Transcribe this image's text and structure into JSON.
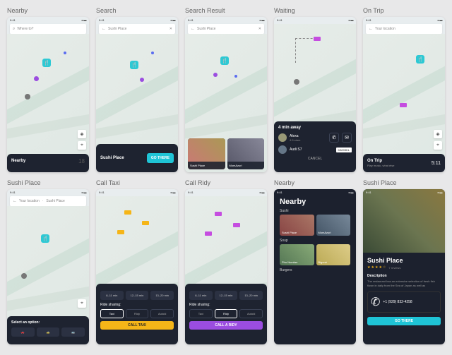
{
  "status": {
    "time": "9:41",
    "icons": "••• ▬"
  },
  "screens": {
    "nearby": {
      "label": "Nearby",
      "search": "Where to?",
      "sheet_title": "Nearby",
      "sheet_num": "18"
    },
    "search": {
      "label": "Search",
      "input": "Sushi Place",
      "card_title": "Sushi Place",
      "card_sub": "",
      "btn": "GO THERE"
    },
    "search_result": {
      "label": "Search Result",
      "input": "Sushi Place",
      "card1": "Sushi Place",
      "card1_sub": "",
      "card2": "MomAzuri",
      "card2_sub": ""
    },
    "waiting": {
      "label": "Waiting",
      "title": "4 min away",
      "driver": "Alexa",
      "rating": "4.5 stars",
      "car": "Audi S7",
      "plate": "K8203KL",
      "cancel": "CANCEL"
    },
    "on_trip": {
      "label": "On Trip",
      "search": "Your location",
      "title": "On Trip",
      "sub": "Play music, what else",
      "time": "5:11"
    },
    "sushi_place": {
      "label": "Sushi Place",
      "crumb1": "Your location",
      "crumb2": "Sushi Place",
      "title": "Select an option:"
    },
    "call_taxi": {
      "label": "Call Taxi",
      "chip1": "8–11 min",
      "chip2": "12–15 min",
      "chip3": "13–20 min",
      "share": "Ride sharing:",
      "p1": "Taxi",
      "p2": "Ridy",
      "p3": "Autoid",
      "btn": "CALL TAXI"
    },
    "call_ridy": {
      "label": "Call Ridy",
      "chip1": "8–11 min",
      "chip2": "12–15 min",
      "chip3": "13–20 min",
      "share": "Ride sharing:",
      "p1": "Taxi",
      "p2": "Ridy",
      "p3": "Autoid",
      "btn": "CALL A RIDY"
    },
    "nearby2": {
      "label": "Nearby",
      "title": "Nearby",
      "cat1": "Sushi",
      "c1a": "Sushi Place",
      "c1b": "MomAzuri",
      "cat2": "Soup",
      "c2a": "Pho Number",
      "c2b": "Bigoné",
      "cat3": "Burgers"
    },
    "detail": {
      "label": "Sushi Place",
      "name": "Sushi Place",
      "reviews": "7 reviews",
      "desc_h": "Description",
      "desc": "The restaurant has an extensive selection of fresh fish flown in daily from the Sea of Japan as well as",
      "phone": "+1 (929) 832-4258",
      "btn": "GO THERE"
    }
  },
  "icons": {
    "fork": "🍴",
    "search": "⌕",
    "back": "←",
    "close": "✕",
    "loc": "⌖",
    "layers": "◈",
    "phone": "✆",
    "msg": "✉"
  }
}
